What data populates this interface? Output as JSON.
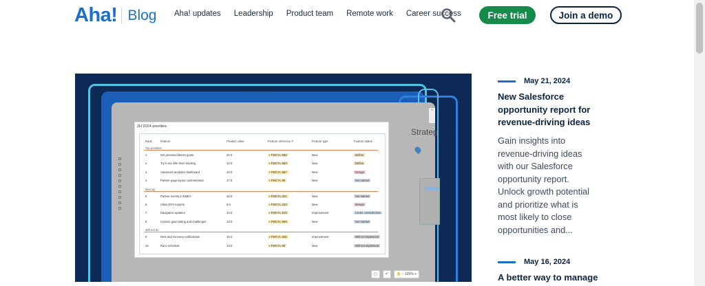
{
  "header": {
    "logo_mark": "Aha!",
    "logo_blog": "Blog",
    "nav": [
      "Aha! updates",
      "Leadership",
      "Product team",
      "Remote work",
      "Career success"
    ],
    "free_trial": "Free trial",
    "join_demo": "Join a demo"
  },
  "hero": {
    "sheet_title": "2H 2024 priorities",
    "columns": [
      "Rank",
      "Feature",
      "Product value",
      "Feature reference #",
      "Feature type",
      "Feature status"
    ],
    "groups": [
      "Top priorities",
      "Next up",
      "Will not do"
    ],
    "rows": [
      {
        "rank": "1",
        "feature": "Set personal fitness goals",
        "value": "20.0",
        "ref": "FWCYL-582",
        "type": "New",
        "status": "Define",
        "status_kind": "define"
      },
      {
        "rank": "2",
        "feature": "Try-it-out elite-level tracking",
        "value": "14.0",
        "ref": "FWCYL-563",
        "type": "New",
        "status": "Define",
        "status_kind": "define"
      },
      {
        "rank": "3",
        "feature": "Advanced analytics dashboard",
        "value": "18.0",
        "ref": "FWCYL-687",
        "type": "New",
        "status": "Design",
        "status_kind": "design"
      },
      {
        "rank": "4",
        "feature": "Partner page layout customization",
        "value": "17.0",
        "ref": "FWCYL-90",
        "type": "New",
        "status": "Not started",
        "status_kind": "ns"
      },
      {
        "rank": "5",
        "feature": "Partner events in EMEA",
        "value": "16.0",
        "ref": "FWCYL-341",
        "type": "New",
        "status": "Not started",
        "status_kind": "ns"
      },
      {
        "rank": "6",
        "feature": "Allow GPX exports",
        "value": "8.0",
        "ref": "FWCYL-319",
        "type": "New",
        "status": "Design",
        "status_kind": "design"
      },
      {
        "rank": "7",
        "feature": "Navigation updates",
        "value": "10.0",
        "ref": "FWCYL-518",
        "type": "Improvement",
        "status": "Under consideration",
        "status_kind": "uc"
      },
      {
        "rank": "8",
        "feature": "Custom goal setting and challenges",
        "value": "13.0",
        "ref": "FWCYL-698",
        "type": "New",
        "status": "Not started",
        "status_kind": "ns"
      },
      {
        "rank": "9",
        "feature": "Rest and recovery notifications",
        "value": "15.0",
        "ref": "FWCYL-636",
        "type": "Improvement",
        "status": "Will not implement",
        "status_kind": "wni"
      },
      {
        "rank": "10",
        "feature": "Race schedule",
        "value": "13.0",
        "ref": "FWCYL-50",
        "type": "New",
        "status": "Will not implement",
        "status_kind": "wni"
      }
    ],
    "side_title": "Strateg",
    "zoom": "125%"
  },
  "posts": [
    {
      "date": "May 21, 2024",
      "title_lines": [
        "New Salesforce",
        "opportunity report for",
        "revenue-driving ideas"
      ],
      "excerpt_lines": [
        "Gain insights into",
        "revenue-driving ideas",
        "with our Salesforce",
        "opportunity report.",
        "Unlock growth potential",
        "and prioritize what is",
        "most likely to close",
        "opportunities and..."
      ]
    },
    {
      "date": "May 16, 2024",
      "title_lines": [
        "A better way to manage"
      ]
    }
  ],
  "colors": {
    "brand_blue": "#1a6fcc",
    "cta_green": "#168a4a",
    "navy": "#0c2340"
  }
}
